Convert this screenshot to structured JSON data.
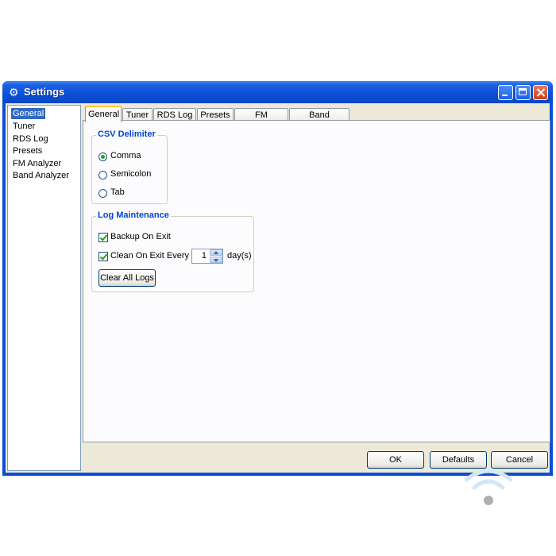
{
  "window": {
    "title": "Settings",
    "icon": "gear-icon",
    "controls": [
      "minimize-icon",
      "maximize-icon",
      "close-icon"
    ]
  },
  "sidebar": {
    "items": [
      {
        "label": "General",
        "selected": true
      },
      {
        "label": "Tuner",
        "selected": false
      },
      {
        "label": "RDS Log",
        "selected": false
      },
      {
        "label": "Presets",
        "selected": false
      },
      {
        "label": "FM Analyzer",
        "selected": false
      },
      {
        "label": "Band Analyzer",
        "selected": false
      }
    ]
  },
  "tabs": [
    {
      "label": "General",
      "active": true
    },
    {
      "label": "Tuner",
      "active": false
    },
    {
      "label": "RDS Log",
      "active": false
    },
    {
      "label": "Presets",
      "active": false
    },
    {
      "label": "FM Analyzer",
      "active": false
    },
    {
      "label": "Band Analyzer",
      "active": false
    }
  ],
  "csv_group": {
    "title": "CSV Delimiter",
    "options": [
      {
        "label": "Comma",
        "checked": true
      },
      {
        "label": "Semicolon",
        "checked": false
      },
      {
        "label": "Tab",
        "checked": false
      }
    ]
  },
  "log_group": {
    "title": "Log Maintenance",
    "backup_label": "Backup On Exit",
    "backup_checked": true,
    "clean_label": "Clean On Exit Every",
    "clean_checked": true,
    "days_value": "1",
    "days_unit": "day(s)",
    "clear_button": "Clear All Logs"
  },
  "footer": {
    "ok": "OK",
    "defaults": "Defaults",
    "cancel": "Cancel"
  },
  "overlay": {
    "icon": "wifi-icon"
  }
}
